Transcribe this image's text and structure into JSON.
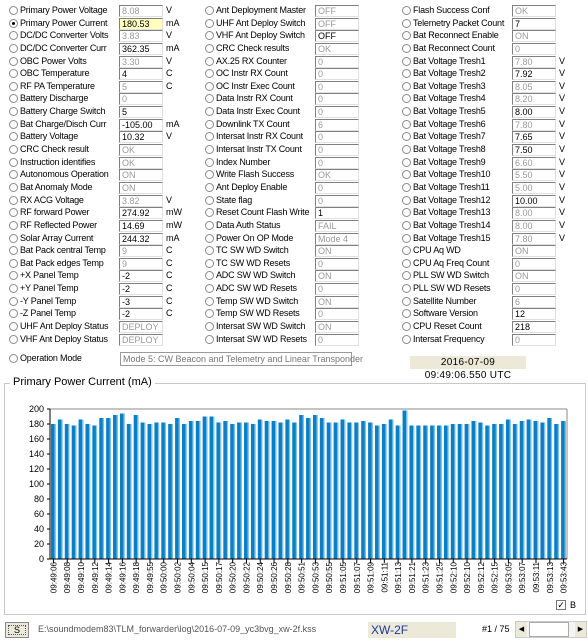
{
  "columns": [
    [
      {
        "label": "Primary Power Voltage",
        "value": "8.08",
        "unit": "V",
        "dis": true
      },
      {
        "label": "Primary Power Current",
        "value": "180.53",
        "unit": "mA",
        "selected": true,
        "hl": true
      },
      {
        "label": "DC/DC Converter Volts",
        "value": "3.83",
        "unit": "V",
        "dis": true
      },
      {
        "label": "DC/DC Converter Curr",
        "value": "362.35",
        "unit": "mA"
      },
      {
        "label": "OBC Power Volts",
        "value": "3.30",
        "unit": "V",
        "dis": true
      },
      {
        "label": "OBC Temperature",
        "value": "4",
        "unit": "C"
      },
      {
        "label": "RF PA Temperature",
        "value": "5",
        "unit": "C",
        "dis": true
      },
      {
        "label": "Battery Discharge",
        "value": "0",
        "dis": true
      },
      {
        "label": "Battery Charge Switch",
        "value": "5"
      },
      {
        "label": "Bat Charge/Disch Curr",
        "value": "-105.00",
        "unit": "mA"
      },
      {
        "label": "Battery Voltage",
        "value": "10.32",
        "unit": "V"
      },
      {
        "label": "CRC Check result",
        "value": "OK",
        "dis": true
      },
      {
        "label": "Instruction identifies",
        "value": "OK",
        "dis": true
      },
      {
        "label": "Autonomous Operation",
        "value": "ON",
        "dis": true
      },
      {
        "label": "Bat Anomaly Mode",
        "value": "ON",
        "dis": true
      },
      {
        "label": "RX ACG Voltage",
        "value": "3.82",
        "unit": "V",
        "dis": true
      },
      {
        "label": "RF forward Power",
        "value": "274.92",
        "unit": "mW"
      },
      {
        "label": "RF Reflected Power",
        "value": "14.69",
        "unit": "mW"
      },
      {
        "label": "Solar Array Current",
        "value": "244.32",
        "unit": "mA"
      },
      {
        "label": "Bat Pack central Temp",
        "value": "9",
        "unit": "C",
        "dis": true
      },
      {
        "label": "Bat Pack edges Temp",
        "value": "9",
        "unit": "C",
        "dis": true
      },
      {
        "label": "+X Panel Temp",
        "value": "-2",
        "unit": "C"
      },
      {
        "label": "+Y Panel Temp",
        "value": "-2",
        "unit": "C"
      },
      {
        "label": "-Y Panel Temp",
        "value": "-3",
        "unit": "C"
      },
      {
        "label": "-Z Panel Temp",
        "value": "-2",
        "unit": "C"
      },
      {
        "label": "UHF Ant Deploy Status",
        "value": "DEPLOY",
        "dis": true
      },
      {
        "label": "VHF Ant Deploy Status",
        "value": "DEPLOY",
        "dis": true
      }
    ],
    [
      {
        "label": "Ant Deployment Master",
        "value": "OFF",
        "dis": true
      },
      {
        "label": "UHF Ant Deploy Switch",
        "value": "OFF",
        "dis": true
      },
      {
        "label": "VHF Ant Deploy Switch",
        "value": "OFF"
      },
      {
        "label": "CRC Check results",
        "value": "OK",
        "dis": true
      },
      {
        "label": "AX.25 RX Counter",
        "value": "0",
        "dis": true
      },
      {
        "label": "OC Instr RX Count",
        "value": "0",
        "dis": true
      },
      {
        "label": "OC Instr Exec Count",
        "value": "0",
        "dis": true
      },
      {
        "label": "Data Instr RX Count",
        "value": "0",
        "dis": true
      },
      {
        "label": "Data Instr Exec Count",
        "value": "0",
        "dis": true
      },
      {
        "label": "Downlink TX Count",
        "value": "6",
        "dis": true
      },
      {
        "label": "Intersat Instr RX Count",
        "value": "0",
        "dis": true
      },
      {
        "label": "Intersat Instr TX Count",
        "value": "0",
        "dis": true
      },
      {
        "label": "Index Number",
        "value": "0",
        "dis": true
      },
      {
        "label": "Write Flash Success",
        "value": "OK",
        "dis": true
      },
      {
        "label": "Ant Deploy Enable",
        "value": "0",
        "dis": true
      },
      {
        "label": "State flag",
        "value": "0",
        "dis": true
      },
      {
        "label": "Reset Count Flash Write",
        "value": "1"
      },
      {
        "label": "Data Auth Status",
        "value": "FAIL",
        "dis": true
      },
      {
        "label": "Power On OP Mode",
        "value": "Mode 4",
        "dis": true
      },
      {
        "label": "TC SW WD Switch",
        "value": "ON",
        "dis": true
      },
      {
        "label": "TC SW WD Resets",
        "value": "0",
        "dis": true
      },
      {
        "label": "ADC SW WD Switch",
        "value": "ON",
        "dis": true
      },
      {
        "label": "ADC SW WD Resets",
        "value": "0",
        "dis": true
      },
      {
        "label": "Temp SW WD Switch",
        "value": "ON",
        "dis": true
      },
      {
        "label": "Temp SW WD Resets",
        "value": "0",
        "dis": true
      },
      {
        "label": "Intersat SW WD Switch",
        "value": "ON",
        "dis": true
      },
      {
        "label": "Intersat SW WD Resets",
        "value": "0",
        "dis": true
      }
    ],
    [
      {
        "label": "Flash Success Conf",
        "value": "OK",
        "dis": true
      },
      {
        "label": "Telemetry Packet Count",
        "value": "7"
      },
      {
        "label": "Bat Reconnect Enable",
        "value": "ON",
        "dis": true
      },
      {
        "label": "Bat Reconnect Count",
        "value": "0",
        "dis": true
      },
      {
        "label": "Bat Voltage Tresh1",
        "value": "7.80",
        "unit": "V",
        "dis": true
      },
      {
        "label": "Bat Voltage Tresh2",
        "value": "7.92",
        "unit": "V"
      },
      {
        "label": "Bat Voltage Tresh3",
        "value": "8.05",
        "unit": "V",
        "dis": true
      },
      {
        "label": "Bat Voltage Tresh4",
        "value": "8.20",
        "unit": "V",
        "dis": true
      },
      {
        "label": "Bat Voltage Tresh5",
        "value": "8.00",
        "unit": "V"
      },
      {
        "label": "Bat Voltage Tresh6",
        "value": "7.80",
        "unit": "V",
        "dis": true
      },
      {
        "label": "Bat Voltage Tresh7",
        "value": "7.65",
        "unit": "V"
      },
      {
        "label": "Bat Voltage Tresh8",
        "value": "7.50",
        "unit": "V"
      },
      {
        "label": "Bat Voltage Tresh9",
        "value": "6.60",
        "unit": "V",
        "dis": true
      },
      {
        "label": "Bat Voltage Tresh10",
        "value": "5.50",
        "unit": "V",
        "dis": true
      },
      {
        "label": "Bat Voltage Tresh11",
        "value": "5.00",
        "unit": "V",
        "dis": true
      },
      {
        "label": "Bat Voltage Tresh12",
        "value": "10.00",
        "unit": "V"
      },
      {
        "label": "Bat Voltage Tresh13",
        "value": "8.00",
        "unit": "V",
        "dis": true
      },
      {
        "label": "Bat Voltage Tresh14",
        "value": "8.00",
        "unit": "V",
        "dis": true
      },
      {
        "label": "Bat Voltage Tresh15",
        "value": "7.80",
        "unit": "V",
        "dis": true
      },
      {
        "label": "CPU Aq WD",
        "value": "ON",
        "dis": true
      },
      {
        "label": "CPU Aq Freq Count",
        "value": "0",
        "dis": true
      },
      {
        "label": "PLL SW WD Switch",
        "value": "ON",
        "dis": true
      },
      {
        "label": "PLL SW WD Resets",
        "value": "0",
        "dis": true
      },
      {
        "label": "Satellite Number",
        "value": "6",
        "dis": true
      },
      {
        "label": "Software Version",
        "value": "12"
      },
      {
        "label": "CPU Reset Count",
        "value": "218"
      },
      {
        "label": "Intersat Frequency",
        "value": "0",
        "dis": true
      }
    ]
  ],
  "operation_mode": {
    "label": "Operation Mode",
    "value": "Mode 5: CW Beacon and Telemetry and Linear Transponder"
  },
  "timestamp": "2016-07-09 09:49:06.550 UTC",
  "chart_title": "Primary Power Current (mA)",
  "checkbox": {
    "label": "B",
    "checked": true
  },
  "bottom": {
    "button": "S",
    "path": "E:\\soundmodem83\\TLM_forwarder\\log\\2016-07-09_yc3bvg_xw-2f.kss",
    "satellite": "XW-2F",
    "page": "#1 / 75"
  },
  "colors": {
    "bar": "#0a7fc6",
    "timestamp_bg": "#ece9d8",
    "satellite_text": "#1a3a9a"
  },
  "chart_data": {
    "type": "bar",
    "title": "Primary Power Current (mA)",
    "ylim": [
      0,
      200
    ],
    "yticks": [
      0,
      20,
      40,
      60,
      80,
      100,
      120,
      140,
      160,
      180,
      200
    ],
    "tick_labels": [
      "09:49:06",
      "09:49:08",
      "09:49:10",
      "09:49:12",
      "09:49:14",
      "09:49:16",
      "09:49:18",
      "09:49:55",
      "09:50:00",
      "09:50:02",
      "09:50:04",
      "09:50:15",
      "09:50:17",
      "09:50:20",
      "09:50:22",
      "09:50:24",
      "09:50:26",
      "09:50:28",
      "09:50:51",
      "09:50:53",
      "09:50:55",
      "09:51:05",
      "09:51:07",
      "09:51:09",
      "09:51:11",
      "09:51:13",
      "09:51:21",
      "09:51:23",
      "09:51:25",
      "09:52:10",
      "09:52:10",
      "09:52:12",
      "09:52:15",
      "09:53:05",
      "09:53:07",
      "09:53:11",
      "09:53:13",
      "09:53:43"
    ],
    "values": [
      180,
      186,
      180,
      178,
      186,
      180,
      178,
      188,
      188,
      192,
      194,
      180,
      192,
      182,
      180,
      182,
      182,
      180,
      188,
      180,
      184,
      184,
      190,
      190,
      182,
      184,
      180,
      182,
      182,
      180,
      186,
      184,
      184,
      182,
      186,
      182,
      192,
      188,
      192,
      188,
      182,
      182,
      186,
      182,
      182,
      184,
      182,
      178,
      180,
      186,
      178,
      198,
      178,
      178,
      178,
      178,
      178,
      178,
      180,
      180,
      180,
      184,
      182,
      178,
      180,
      180,
      186,
      180,
      184,
      186,
      184,
      182,
      188,
      180,
      184
    ]
  }
}
